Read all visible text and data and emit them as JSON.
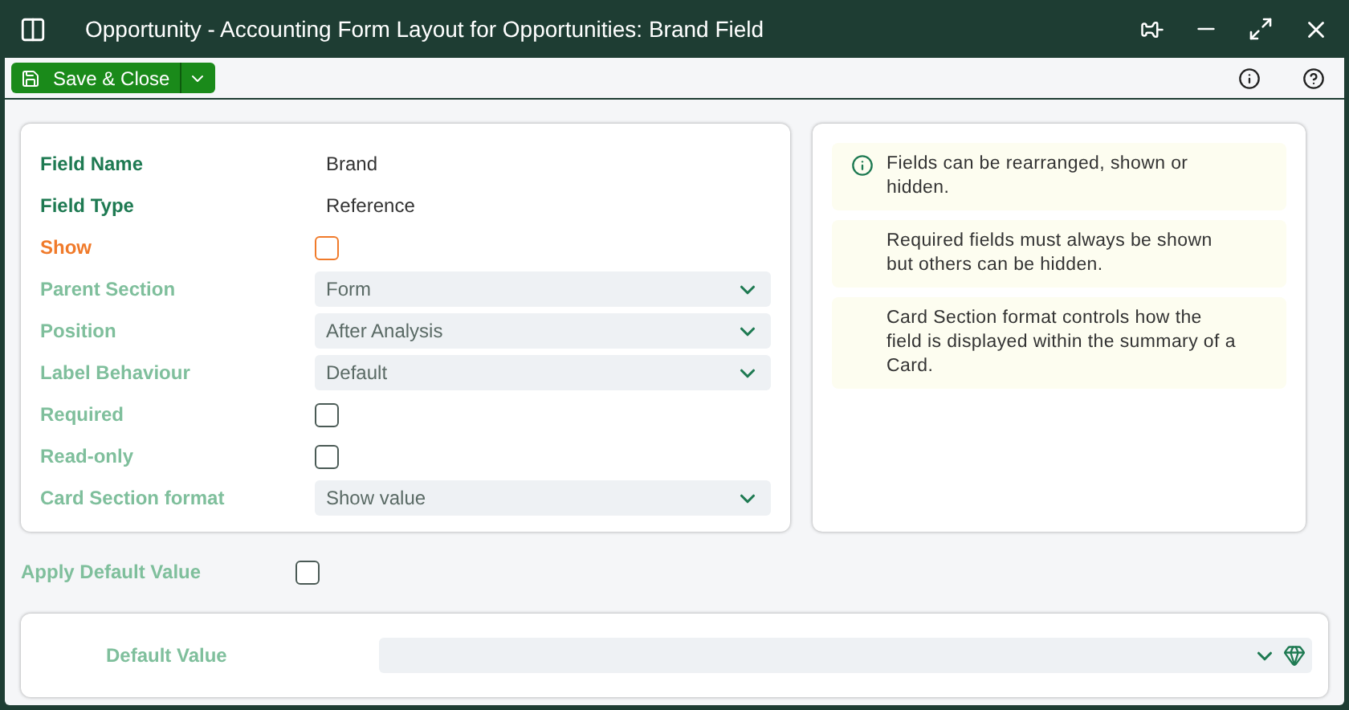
{
  "window": {
    "title": "Opportunity - Accounting Form Layout for Opportunities: Brand Field"
  },
  "toolbar": {
    "save_button": "Save & Close"
  },
  "fields": [
    {
      "label": "Field Name",
      "color": "#1e7a52",
      "kind": "text",
      "value": "Brand"
    },
    {
      "label": "Field Type",
      "color": "#1e7a52",
      "kind": "text",
      "value": "Reference"
    },
    {
      "label": "Show",
      "color": "#f07a2a",
      "kind": "checkbox",
      "checked": false
    },
    {
      "label": "Parent Section",
      "color": "#7fbf9c",
      "kind": "select",
      "value": "Form"
    },
    {
      "label": "Position",
      "color": "#7fbf9c",
      "kind": "select",
      "value": "After Analysis"
    },
    {
      "label": "Label Behaviour",
      "color": "#7fbf9c",
      "kind": "select",
      "value": "Default"
    },
    {
      "label": "Required",
      "color": "#7fbf9c",
      "kind": "checkbox",
      "checked": false
    },
    {
      "label": "Read-only",
      "color": "#7fbf9c",
      "kind": "checkbox",
      "checked": false
    },
    {
      "label": "Card Section format",
      "color": "#7fbf9c",
      "kind": "select",
      "value": "Show value"
    }
  ],
  "notes": [
    {
      "text": "Fields can be rearranged, shown or hidden.",
      "icon": true
    },
    {
      "text": "Required fields must always be shown but others can be hidden.",
      "icon": false
    },
    {
      "text": "Card Section format controls how the field is displayed within the summary of a Card.",
      "icon": false
    }
  ],
  "apply_default": {
    "label": "Apply Default Value",
    "checked": false
  },
  "default_value": {
    "label": "Default Value"
  }
}
